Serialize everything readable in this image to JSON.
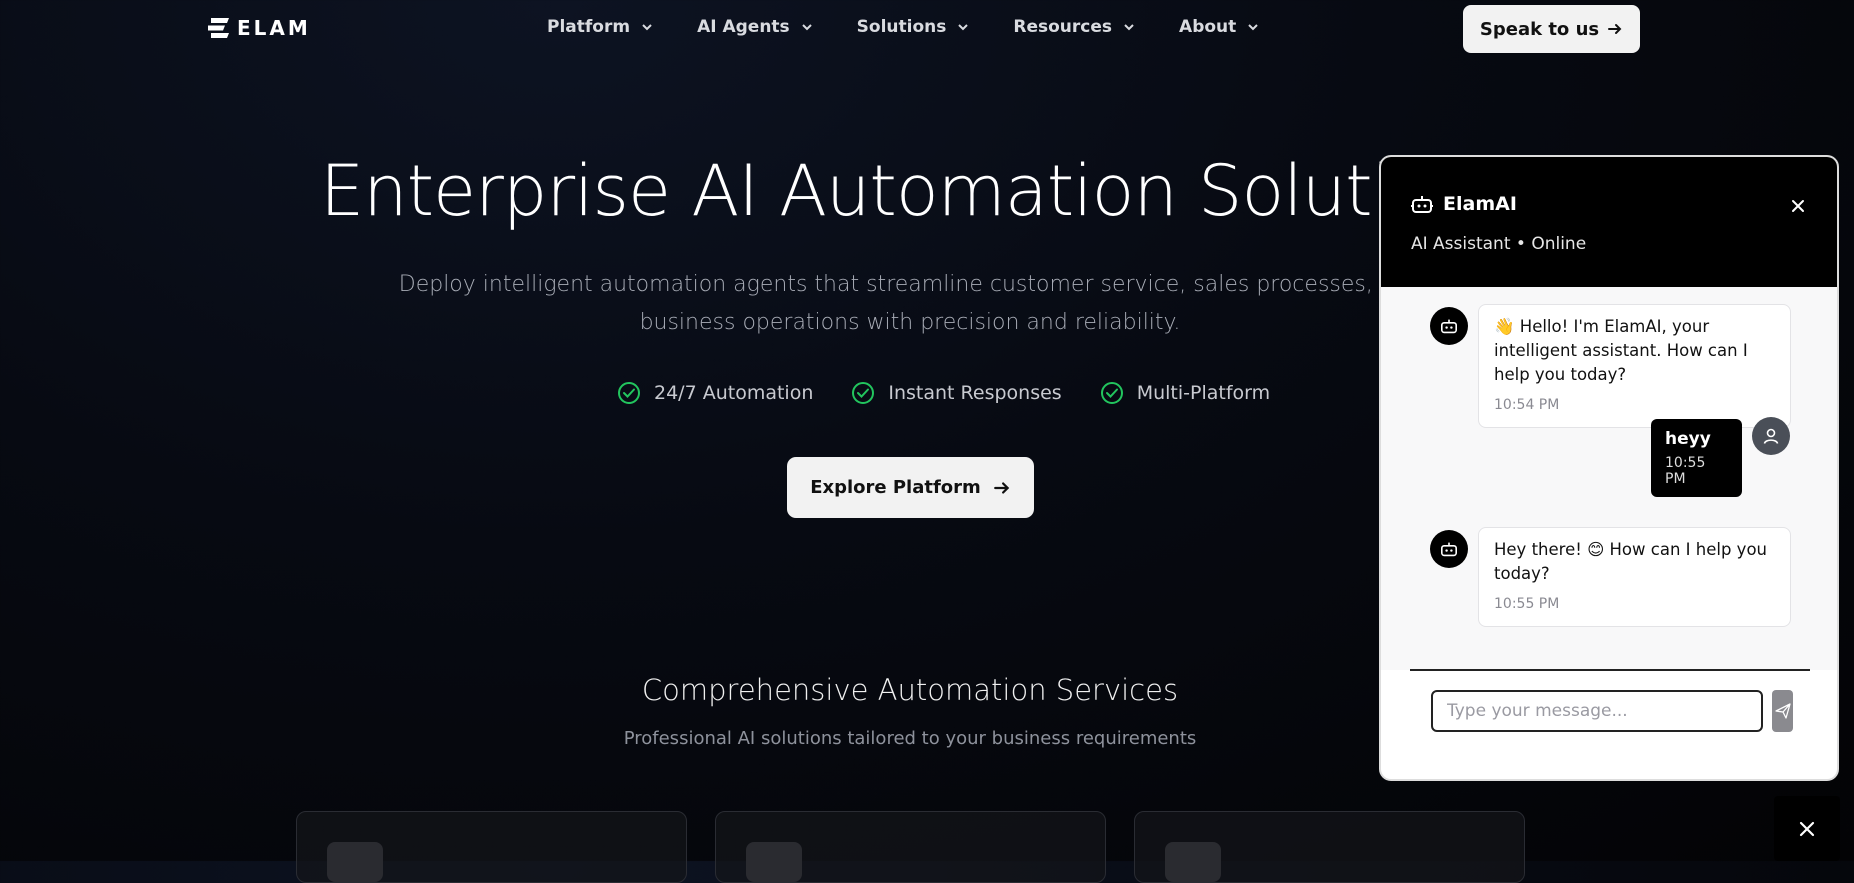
{
  "header": {
    "logo_text": "ELAM",
    "nav": [
      {
        "label": "Platform"
      },
      {
        "label": "AI Agents"
      },
      {
        "label": "Solutions"
      },
      {
        "label": "Resources"
      },
      {
        "label": "About"
      }
    ],
    "cta_label": "Speak to us"
  },
  "hero": {
    "title": "Enterprise AI Automation Solutions",
    "subtitle": "Deploy intelligent automation agents that streamline customer service, sales processes, and business operations with precision and reliability.",
    "features": [
      "24/7 Automation",
      "Instant Responses",
      "Multi-Platform"
    ],
    "button_label": "Explore Platform"
  },
  "services": {
    "title": "Comprehensive Automation Services",
    "subtitle": "Professional AI solutions tailored to your business requirements"
  },
  "chat": {
    "title": "ElamAI",
    "status": "AI Assistant • Online",
    "messages": [
      {
        "from": "bot",
        "text": "👋 Hello! I'm ElamAI, your intelligent assistant. How can I help you today?",
        "time": "10:54 PM"
      },
      {
        "from": "user",
        "text": "heyy",
        "time": "10:55 PM"
      },
      {
        "from": "bot",
        "text": "Hey there! 😊 How can I help you today?",
        "time": "10:55 PM"
      }
    ],
    "input_placeholder": "Type your message..."
  },
  "colors": {
    "check_green": "#22c55e",
    "button_bg": "#f2f2f2",
    "chat_header": "#000000"
  }
}
